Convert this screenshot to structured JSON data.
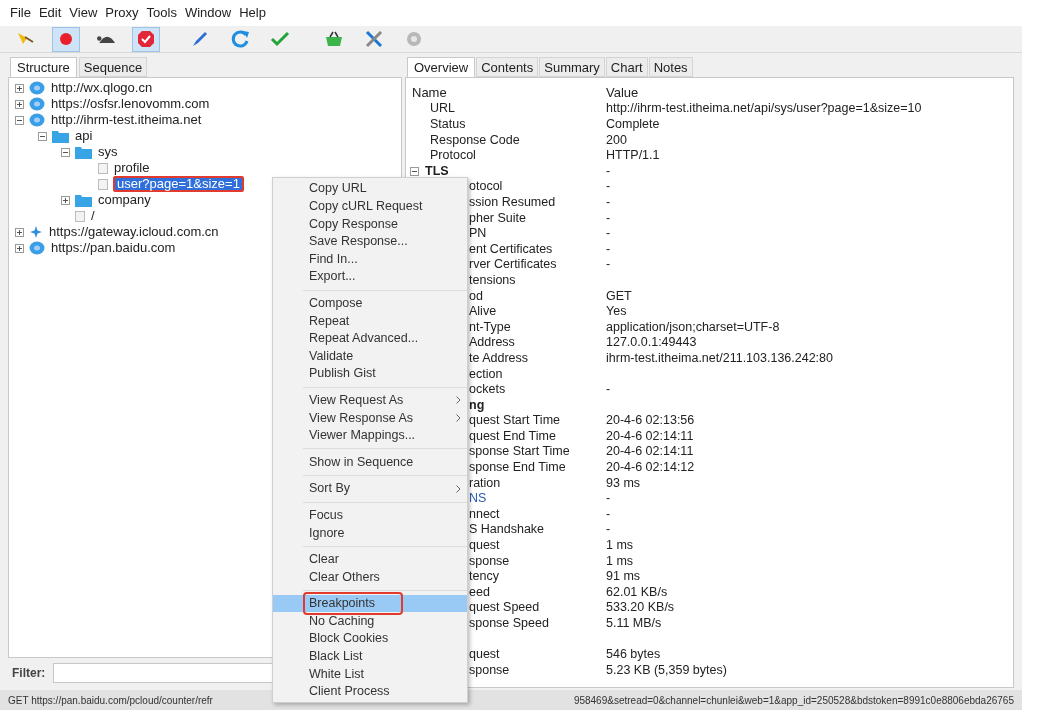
{
  "menu_bar": [
    "File",
    "Edit",
    "View",
    "Proxy",
    "Tools",
    "Window",
    "Help"
  ],
  "toolbar": [
    {
      "kind": "broom",
      "pressed": false
    },
    {
      "kind": "record",
      "pressed": true
    },
    {
      "kind": "throttle",
      "pressed": false
    },
    {
      "kind": "breakpoint",
      "pressed": true
    },
    {
      "kind": "pen",
      "pressed": false
    },
    {
      "kind": "refresh",
      "pressed": false
    },
    {
      "kind": "check",
      "pressed": false
    },
    {
      "kind": "basket",
      "pressed": false
    },
    {
      "kind": "tools",
      "pressed": false
    },
    {
      "kind": "gear",
      "pressed": false
    }
  ],
  "left_tabs": [
    {
      "label": "Structure",
      "selected": true
    },
    {
      "label": "Sequence",
      "selected": false
    }
  ],
  "tree": [
    {
      "label": "http://wx.qlogo.cn",
      "kind": "host",
      "expanded": false,
      "selected": false
    },
    {
      "label": "https://osfsr.lenovomm.com",
      "kind": "host",
      "expanded": false,
      "selected": false
    },
    {
      "label": "http://ihrm-test.itheima.net",
      "kind": "host",
      "expanded": true,
      "selected": false,
      "children": [
        {
          "label": "api",
          "kind": "folder",
          "expanded": true,
          "selected": false,
          "children": [
            {
              "label": "sys",
              "kind": "folder",
              "expanded": true,
              "selected": false,
              "children": [
                {
                  "label": "profile",
                  "kind": "leaf",
                  "selected": false
                },
                {
                  "label": "user?page=1&size=1",
                  "kind": "leaf",
                  "selected": true
                }
              ]
            },
            {
              "label": "company",
              "kind": "folder",
              "expanded": false,
              "selected": false
            },
            {
              "label": "/",
              "kind": "leaf",
              "selected": false
            }
          ]
        }
      ]
    },
    {
      "label": "https://gateway.icloud.com.cn",
      "kind": "star-host",
      "expanded": false,
      "selected": false
    },
    {
      "label": "https://pan.baidu.com",
      "kind": "host",
      "expanded": false,
      "selected": false
    }
  ],
  "filter": {
    "label": "Filter:"
  },
  "right_tabs": [
    {
      "label": "Overview",
      "selected": true
    },
    {
      "label": "Contents",
      "selected": false
    },
    {
      "label": "Summary",
      "selected": false
    },
    {
      "label": "Chart",
      "selected": false
    },
    {
      "label": "Notes",
      "selected": false
    }
  ],
  "overview": {
    "columns": [
      "Name",
      "Value"
    ],
    "rows": [
      {
        "kind": "row",
        "name": "URL",
        "value": "http://ihrm-test.itheima.net/api/sys/user?page=1&size=10"
      },
      {
        "kind": "row",
        "name": "Status",
        "value": "Complete"
      },
      {
        "kind": "row",
        "name": "Response Code",
        "value": "200"
      },
      {
        "kind": "row",
        "name": "Protocol",
        "value": "HTTP/1.1"
      },
      {
        "kind": "group",
        "name": "TLS",
        "value": "-"
      },
      {
        "kind": "covered",
        "name": "otocol",
        "value": "-"
      },
      {
        "kind": "covered",
        "name": "ssion Resumed",
        "value": "-"
      },
      {
        "kind": "covered",
        "name": "pher Suite",
        "value": "-"
      },
      {
        "kind": "covered",
        "name": "PN",
        "value": "-"
      },
      {
        "kind": "covered",
        "name": "ent Certificates",
        "value": "-"
      },
      {
        "kind": "covered",
        "name": "rver Certificates",
        "value": "-"
      },
      {
        "kind": "covered",
        "name": "tensions"
      },
      {
        "kind": "covered",
        "name": "od",
        "value": "GET"
      },
      {
        "kind": "covered",
        "name": "Alive",
        "value": "Yes"
      },
      {
        "kind": "covered",
        "name": "nt-Type",
        "value": "application/json;charset=UTF-8"
      },
      {
        "kind": "covered",
        "name": "Address",
        "value": "127.0.0.1:49443"
      },
      {
        "kind": "covered",
        "name": "te Address",
        "value": "ihrm-test.itheima.net/211.103.136.242:80"
      },
      {
        "kind": "covered",
        "name": "ection"
      },
      {
        "kind": "covered",
        "name": "ockets",
        "value": "-"
      },
      {
        "kind": "covered-group",
        "name": "ng"
      },
      {
        "kind": "covered",
        "name": "quest Start Time",
        "value": "20-4-6 02:13:56"
      },
      {
        "kind": "covered",
        "name": "quest End Time",
        "value": "20-4-6 02:14:11"
      },
      {
        "kind": "covered",
        "name": "sponse Start Time",
        "value": "20-4-6 02:14:11"
      },
      {
        "kind": "covered",
        "name": "sponse End Time",
        "value": "20-4-6 02:14:12"
      },
      {
        "kind": "covered",
        "name": "ration",
        "value": "93 ms"
      },
      {
        "kind": "covered-link",
        "name": "NS",
        "value": "-"
      },
      {
        "kind": "covered",
        "name": "nnect",
        "value": "-"
      },
      {
        "kind": "covered",
        "name": "S Handshake",
        "value": "-"
      },
      {
        "kind": "covered",
        "name": "quest",
        "value": "1 ms"
      },
      {
        "kind": "covered",
        "name": "sponse",
        "value": "1 ms"
      },
      {
        "kind": "covered",
        "name": "tency",
        "value": "91 ms"
      },
      {
        "kind": "covered",
        "name": "eed",
        "value": "62.01 KB/s"
      },
      {
        "kind": "covered",
        "name": "quest Speed",
        "value": "533.20 KB/s"
      },
      {
        "kind": "covered",
        "name": "sponse Speed",
        "value": "5.11 MB/s"
      },
      {
        "kind": "spacer"
      },
      {
        "kind": "covered",
        "name": "quest",
        "value": "546 bytes"
      },
      {
        "kind": "covered",
        "name": "sponse",
        "value": "5.23 KB (5,359 bytes)"
      }
    ]
  },
  "context_menu": [
    {
      "kind": "item",
      "label": "Copy URL",
      "selected": false
    },
    {
      "kind": "item",
      "label": "Copy cURL Request",
      "selected": false
    },
    {
      "kind": "item",
      "label": "Copy Response",
      "selected": false
    },
    {
      "kind": "item",
      "label": "Save Response...",
      "selected": false
    },
    {
      "kind": "item",
      "label": "Find In...",
      "selected": false
    },
    {
      "kind": "item",
      "label": "Export...",
      "selected": false
    },
    {
      "kind": "separator"
    },
    {
      "kind": "item",
      "label": "Compose",
      "selected": false
    },
    {
      "kind": "item",
      "label": "Repeat",
      "selected": false
    },
    {
      "kind": "item",
      "label": "Repeat Advanced...",
      "selected": false
    },
    {
      "kind": "item",
      "label": "Validate",
      "selected": false
    },
    {
      "kind": "item",
      "label": "Publish Gist",
      "selected": false
    },
    {
      "kind": "separator"
    },
    {
      "kind": "submenu",
      "label": "View Request As",
      "selected": false
    },
    {
      "kind": "submenu",
      "label": "View Response As",
      "selected": false
    },
    {
      "kind": "item",
      "label": "Viewer Mappings...",
      "selected": false
    },
    {
      "kind": "separator"
    },
    {
      "kind": "item",
      "label": "Show in Sequence",
      "selected": false
    },
    {
      "kind": "separator"
    },
    {
      "kind": "submenu",
      "label": "Sort By",
      "selected": false
    },
    {
      "kind": "separator"
    },
    {
      "kind": "item",
      "label": "Focus",
      "selected": false
    },
    {
      "kind": "item",
      "label": "Ignore",
      "selected": false
    },
    {
      "kind": "separator"
    },
    {
      "kind": "item",
      "label": "Clear",
      "selected": false
    },
    {
      "kind": "item",
      "label": "Clear Others",
      "selected": false
    },
    {
      "kind": "separator"
    },
    {
      "kind": "item",
      "label": "Breakpoints",
      "selected": true
    },
    {
      "kind": "item",
      "label": "No Caching",
      "selected": false
    },
    {
      "kind": "item",
      "label": "Block Cookies",
      "selected": false
    },
    {
      "kind": "item",
      "label": "Black List",
      "selected": false
    },
    {
      "kind": "item",
      "label": "White List",
      "selected": false
    },
    {
      "kind": "item",
      "label": "Client Process",
      "selected": false
    }
  ],
  "status_bar": {
    "left": "GET https://pan.baidu.com/pcloud/counter/refr",
    "right": "958469&setread=0&channel=chunlei&web=1&app_id=250528&bdstoken=8991c0e8806ebda26765"
  }
}
